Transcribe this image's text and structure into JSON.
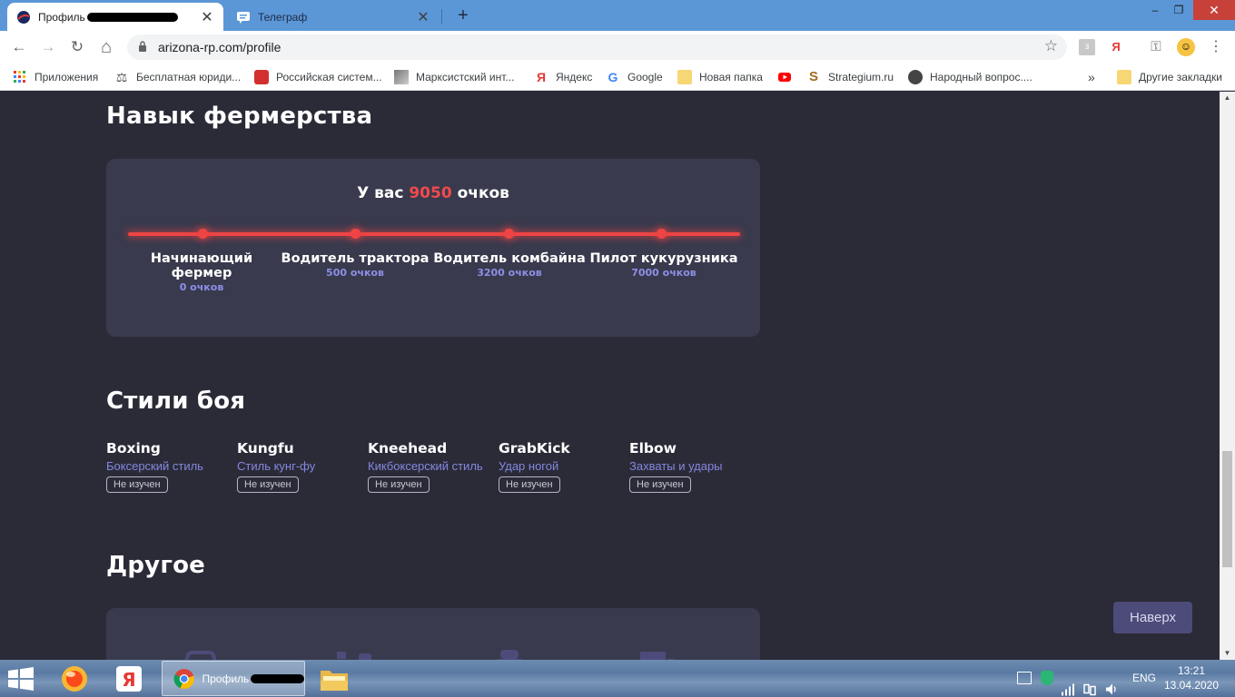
{
  "browser": {
    "tabs": [
      {
        "title": "Профиль",
        "active": true
      },
      {
        "title": "Телеграф",
        "active": false
      }
    ],
    "new_tab_label": "+",
    "window_controls": {
      "minimize": "–",
      "maximize": "❐",
      "close": "✕"
    },
    "url": "arizona-rp.com/profile",
    "nav": {
      "back": "←",
      "forward": "→",
      "reload": "↻",
      "home": "⌂"
    },
    "extensions": [
      "Я"
    ],
    "bookmarks": [
      {
        "label": "Приложения",
        "icon": "apps-grid-icon"
      },
      {
        "label": "Бесплатная юриди...",
        "icon": "scales-icon"
      },
      {
        "label": "Российская систем...",
        "icon": "red-shield-icon"
      },
      {
        "label": "Марксистский инт...",
        "icon": "portrait-icon"
      },
      {
        "label": "Яндекс",
        "icon": "yandex-icon"
      },
      {
        "label": "Google",
        "icon": "google-icon"
      },
      {
        "label": "Новая папка",
        "icon": "folder-icon"
      },
      {
        "label": "",
        "icon": "youtube-icon"
      },
      {
        "label": "Strategium.ru",
        "icon": "strategium-icon"
      },
      {
        "label": "Народный вопрос....",
        "icon": "globe-icon"
      }
    ],
    "bookmarks_overflow": "»",
    "other_bookmarks": "Другие закладки"
  },
  "farming": {
    "heading": "Навык фермерства",
    "points_prefix": "У вас",
    "points_value": "9050",
    "points_suffix": "очков",
    "ranks": [
      {
        "title": "Начинающий фермер",
        "points": "0 очков"
      },
      {
        "title": "Водитель трактора",
        "points": "500 очков"
      },
      {
        "title": "Водитель комбайна",
        "points": "3200 очков"
      },
      {
        "title": "Пилот кукурузника",
        "points": "7000 очков"
      }
    ]
  },
  "fighting": {
    "heading": "Стили боя",
    "styles": [
      {
        "name": "Boxing",
        "desc": "Боксерский стиль",
        "status": "Не изучен"
      },
      {
        "name": "Kungfu",
        "desc": "Стиль кунг-фу",
        "status": "Не изучен"
      },
      {
        "name": "Kneehead",
        "desc": "Кикбоксерский стиль",
        "status": "Не изучен"
      },
      {
        "name": "GrabKick",
        "desc": "Удар ногой",
        "status": "Не изучен"
      },
      {
        "name": "Elbow",
        "desc": "Захваты и удары",
        "status": "Не изучен"
      }
    ]
  },
  "other": {
    "heading": "Другое"
  },
  "scroll_top_button": "Наверх",
  "taskbar": {
    "active_window_title": "Профиль",
    "tray": {
      "language": "ENG"
    },
    "clock": {
      "time": "13:21",
      "date": "13.04.2020"
    }
  },
  "colors": {
    "page_bg": "#2b2b38",
    "card_bg": "#393a4d",
    "accent_red": "#ef4444",
    "accent_purple": "#8587e0"
  }
}
